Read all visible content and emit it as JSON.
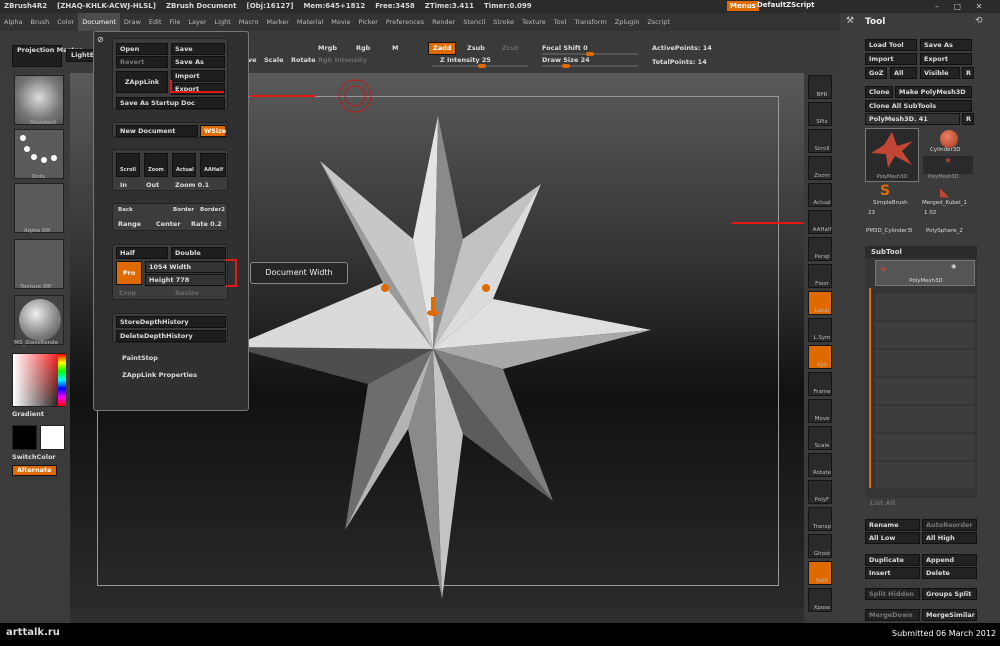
{
  "titlebar": {
    "app": "ZBrush4R2",
    "serial": "[ZHAQ-KHLK-ACWJ-HLSL]",
    "doc": "ZBrush Document",
    "obj": "[Obj:16127]",
    "mem": "Mem:645+1812",
    "free": "Free:3458",
    "ztime": "ZTime:3.411",
    "timer": "Timer:0.099",
    "menus_btn": "Menus",
    "script": "DefaultZScript"
  },
  "menubar": [
    "Alpha",
    "Brush",
    "Color",
    "Document",
    "Draw",
    "Edit",
    "File",
    "Layer",
    "Light",
    "Macro",
    "Marker",
    "Material",
    "Movie",
    "Picker",
    "Preferences",
    "Render",
    "Stencil",
    "Stroke",
    "Texture",
    "Tool",
    "Transform",
    "Zplugin",
    "Zscript"
  ],
  "shelf": {
    "projection_master": "Projection Master",
    "lightbox": "LightBox",
    "move": "Move",
    "scale": "Scale",
    "rotate": "Rotate",
    "mrgb": "Mrgb",
    "rgb": "Rgb",
    "m": "M",
    "rgb_intensity": "Rgb Intensity",
    "zadd": "Zadd",
    "zsub": "Zsub",
    "zcut": "Zcut",
    "z_intensity": "Z Intensity 25",
    "focal_shift": "Focal Shift 0",
    "draw_size": "Draw Size 24",
    "active_points": "ActivePoints: 14",
    "total_points": "TotalPoints: 14"
  },
  "popup": {
    "open": "Open",
    "save": "Save",
    "revert": "Revert",
    "save_as": "Save As",
    "zapplink": "ZAppLink",
    "import": "Import",
    "export": "Export",
    "save_startup": "Save As Startup Doc",
    "new_document": "New Document",
    "wsize": "WSize",
    "scroll": "Scroll",
    "zoom": "Zoom",
    "actual": "Actual",
    "aahalf": "AAHalf",
    "in": "In",
    "out": "Out",
    "zoom_val": "Zoom 0.1",
    "back": "Back",
    "border": "Border",
    "border2": "Border2",
    "range": "Range",
    "center": "Center",
    "rate": "Rate 0.2",
    "half": "Half",
    "double": "Double",
    "pro": "Pro",
    "width": "1054 Width",
    "height": "Height 778",
    "crop": "Crop",
    "resize": "Resize",
    "store_depth": "StoreDepthHistory",
    "delete_depth": "DeleteDepthHistory",
    "paintstop": "PaintStop",
    "zapplink_props": "ZAppLink Properties"
  },
  "tooltip": "Document Width",
  "lefttray": {
    "standard": "Standard",
    "dots": "Dots",
    "alpha_off": "Alpha Off",
    "texture_off": "Texture Off",
    "material": "MS_GlassRende",
    "gradient": "Gradient",
    "switchcolor": "SwitchColor",
    "alternate": "Alternate"
  },
  "vtray": [
    "BPR",
    "SPix",
    "Scroll",
    "Zoom",
    "Actual",
    "AAHalf",
    "Persp",
    "Floor",
    "Local",
    "L.Sym",
    "Xyz",
    "Frame",
    "Move",
    "Scale",
    "Rotate",
    "PolyF",
    "Transp",
    "Ghost",
    "Solo",
    "Xpose"
  ],
  "tool": {
    "title": "Tool",
    "load_tool": "Load Tool",
    "save_as": "Save As",
    "import": "Import",
    "export": "Export",
    "goz": "GoZ",
    "all": "All",
    "visible": "Visible",
    "r": "R",
    "clone": "Clone",
    "make_polymesh": "Make PolyMesh3D",
    "clone_all": "Clone All SubTools",
    "polymesh_slider": "PolyMesh3D. 41",
    "tools": [
      "PolyMesh3D",
      "Cylinder3D",
      "PolyMesh3D",
      "SimpleBrush",
      "Merged_Kubel_1",
      "PM3D_Cylinder3l",
      "PolySphere_2"
    ],
    "num_a": "23",
    "num_b": "1 02",
    "subtool": "SubTool",
    "subtool_item": "PolyMesh3D",
    "list_all": "List All",
    "rename": "Rename",
    "autoreorder": "AutoReorder",
    "all_low": "All Low",
    "all_high": "All High",
    "duplicate": "Duplicate",
    "append": "Append",
    "insert": "Insert",
    "delete": "Delete",
    "split_hidden": "Split Hidden",
    "groups_split": "Groups Split",
    "merge_down": "MergeDown",
    "merge_similar": "MergeSimilar"
  },
  "footer": {
    "logo": "arttalk.ru",
    "submitted": "Submitted 06 March 2012"
  }
}
